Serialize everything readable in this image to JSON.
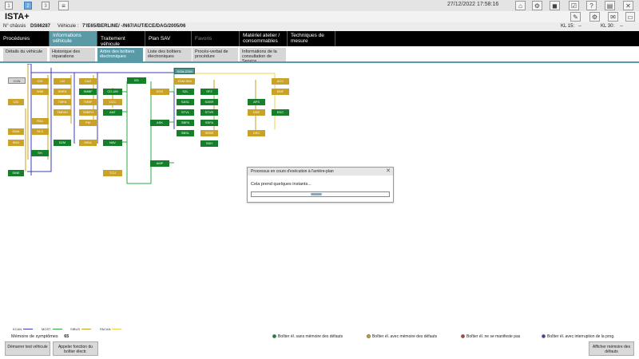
{
  "topbar": {
    "pages": [
      "1",
      "2",
      "3"
    ],
    "datetime": "27/12/2022 17:58:16"
  },
  "app": {
    "title": "ISTA+"
  },
  "info": {
    "chassis_label": "N° châssis",
    "chassis_value": "DS66287",
    "vehicle_label": "Véhicule :",
    "vehicle_value": "7'/E65/BERLINE/ -/N67/AUT/ECE/DAG/2005/06",
    "kl15_label": "KL 15:",
    "kl15_value": "--",
    "kl30_label": "KL 30:",
    "kl30_value": "--"
  },
  "mainnav": {
    "tabs": [
      "Procédures",
      "Informations véhicule",
      "Traitement véhicule",
      "Plan SAV",
      "Favoris",
      "Matériel atelier / consommables",
      "Techniques de mesure"
    ]
  },
  "subnav": {
    "tabs": [
      "Détails du véhicule",
      "Historique des réparations",
      "Arbre des boîtiers électroniques",
      "Liste des boîtiers électroniques",
      "Procès-verbal de procédure",
      "Informations de la consultation de Service"
    ]
  },
  "colors": {
    "kcan": "#3c3cb4",
    "most": "#2fa84a",
    "sibus": "#c9a227",
    "pacan": "#f2d24a",
    "accent": "#5a9aa6",
    "ok": "#167f2a"
  },
  "nodes": [
    "CON",
    "CID",
    "LM",
    "CAS",
    "CD-UM",
    "ED",
    "SGM-ZGM",
    "EGS",
    "PM",
    "WIM",
    "SMFA",
    "SMBF",
    "ZGM-SIM",
    "SZL",
    "SFZ",
    "ACC",
    "TMFA",
    "TMBF",
    "CCC",
    "SASL",
    "SASR",
    "AFS",
    "EMF",
    "TMFAH",
    "TMBFH",
    "ANT",
    "STVL",
    "STVR",
    "DDE",
    "EDC",
    "FDU",
    "PM",
    "ASK",
    "SBFA",
    "SSFA",
    "DMA",
    "RLS",
    "SZM",
    "IHKA",
    "NAV",
    "SBSL",
    "SBSR",
    "DSC",
    "SHD",
    "SH",
    "SHD",
    "VM",
    "AMP",
    "SINE",
    "TCU",
    "SSH"
  ],
  "dialog": {
    "title": "Processus en cours d'exécution à l'arrière-plan",
    "close": "✕",
    "message": "Cela prend quelques instants...",
    "progress": 0.43
  },
  "legend": {
    "buses": [
      "KCAN",
      "MOST",
      "SIBUS",
      "PACAN"
    ]
  },
  "symptom": {
    "label": "Mémoire de symptômes",
    "count": "65"
  },
  "status_legend": [
    "Boîtier él. sans mémoire des défauts",
    "Boîtier él. avec mémoire des défauts",
    "Boîtier él. ne se manifeste pas",
    "Boîtier él. avec interruption de la prog."
  ],
  "buttons": {
    "start_test": "Démarrer test véhicule",
    "call_function": "Appeler fonction du boîtier électr.",
    "show_memory": "Afficher mémoire des défauts"
  }
}
